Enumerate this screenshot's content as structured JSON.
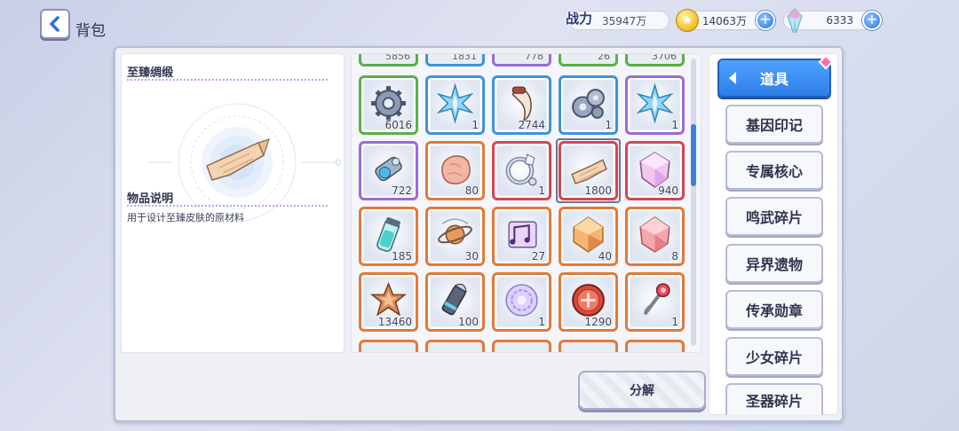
{
  "header": {
    "title": "背包",
    "power_label": "战力",
    "power_value": "35947万",
    "gold_value": "14063万",
    "gem_value": "6333",
    "gold_icon": "star-coin-icon",
    "gem_icon": "crystal-icon"
  },
  "detail": {
    "item_name": "至臻绸缎",
    "desc_title": "物品说明",
    "desc_text": "用于设计至臻皮肤的原材料"
  },
  "grid": {
    "peek_counts": [
      "5856",
      "1831",
      "778",
      "26",
      "3706"
    ],
    "rows": [
      [
        {
          "icon": "gear-icon",
          "count": "6016",
          "rarity": "green"
        },
        {
          "icon": "ice-star-crystal-icon",
          "count": "1",
          "rarity": "blue"
        },
        {
          "icon": "claw-tooth-icon",
          "count": "2744",
          "rarity": "blue"
        },
        {
          "icon": "gear-cluster-icon",
          "count": "1",
          "rarity": "blue"
        },
        {
          "icon": "ice-star-crystal-icon",
          "count": "1",
          "rarity": "purple"
        }
      ],
      [
        {
          "icon": "mech-arm-icon",
          "count": "722",
          "rarity": "purple"
        },
        {
          "icon": "ore-stone-icon",
          "count": "80",
          "rarity": "orange"
        },
        {
          "icon": "ring-icon",
          "count": "1",
          "rarity": "red"
        },
        {
          "icon": "silk-cloth-icon",
          "count": "1800",
          "rarity": "red",
          "selected": true
        },
        {
          "icon": "pink-gem-icon",
          "count": "940",
          "rarity": "red"
        }
      ],
      [
        {
          "icon": "vial-icon",
          "count": "185",
          "rarity": "orange"
        },
        {
          "icon": "planet-ring-icon",
          "count": "30",
          "rarity": "orange"
        },
        {
          "icon": "music-score-icon",
          "count": "27",
          "rarity": "orange"
        },
        {
          "icon": "amber-crystal-icon",
          "count": "40",
          "rarity": "orange"
        },
        {
          "icon": "rose-crystal-icon",
          "count": "8",
          "rarity": "orange"
        }
      ],
      [
        {
          "icon": "star-badge-icon",
          "count": "13460",
          "rarity": "orange"
        },
        {
          "icon": "bullet-icon",
          "count": "100",
          "rarity": "orange"
        },
        {
          "icon": "magic-circle-icon",
          "count": "1",
          "rarity": "orange"
        },
        {
          "icon": "red-coin-icon",
          "count": "1290",
          "rarity": "orange"
        },
        {
          "icon": "key-wand-icon",
          "count": "1",
          "rarity": "orange"
        }
      ]
    ]
  },
  "actions": {
    "decompose_label": "分解"
  },
  "categories": {
    "active": "道具",
    "items": [
      "基因印记",
      "专属核心",
      "鸣武碎片",
      "异界遗物",
      "传承勋章",
      "少女碎片",
      "圣器碎片"
    ]
  },
  "colors": {
    "accent": "#2f7ee8",
    "green": "#5cae4a",
    "blue": "#3f93d8",
    "purple": "#9a6bd6",
    "red": "#d6454f",
    "orange": "#e07a3a"
  }
}
